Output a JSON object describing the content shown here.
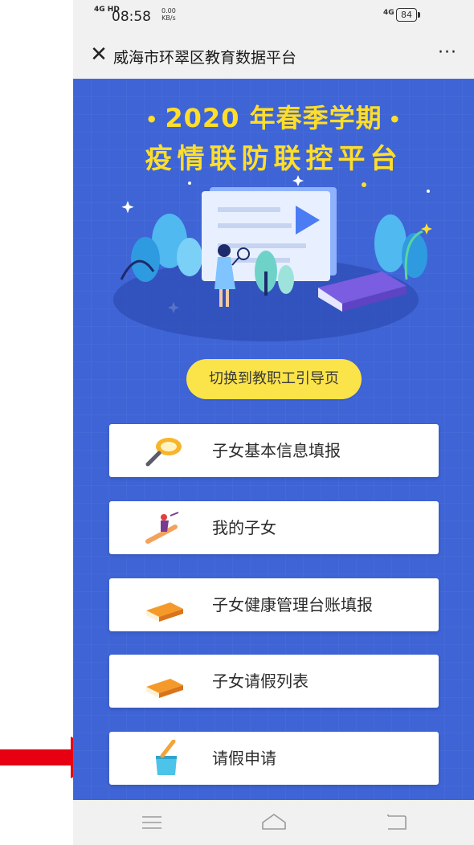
{
  "status_bar": {
    "signal": "4G HD",
    "time": "08:58",
    "speed_value": "0.00",
    "speed_unit": "KB/s",
    "network": "4G",
    "battery": "84"
  },
  "title_bar": {
    "close_icon": "close-icon",
    "title": "威海市环翠区教育数据平台",
    "more_label": "···"
  },
  "hero": {
    "line1": "2020 年春季学期",
    "line2": "疫情联防联控平台",
    "accent_color": "#ffde2a",
    "background_color": "#3e64d6"
  },
  "switch_button": {
    "label": "切换到教职工引导页"
  },
  "menu": [
    {
      "label": "子女基本信息填报",
      "icon": "magnifier-icon"
    },
    {
      "label": "我的子女",
      "icon": "pencil-rider-icon"
    },
    {
      "label": "子女健康管理台账填报",
      "icon": "book-icon"
    },
    {
      "label": "子女请假列表",
      "icon": "book-icon"
    },
    {
      "label": "请假申请",
      "icon": "pencil-cup-icon"
    }
  ],
  "nav_bar": {
    "menu_icon": "menu-icon",
    "home_icon": "home-icon",
    "back_icon": "back-icon"
  },
  "annotation": {
    "arrow_color": "#e60012"
  }
}
